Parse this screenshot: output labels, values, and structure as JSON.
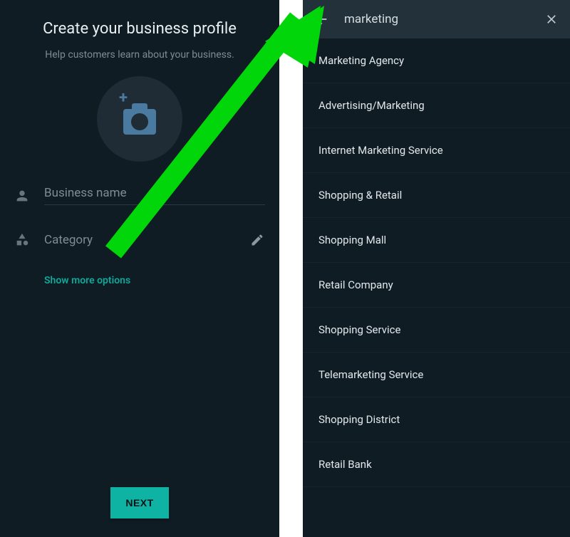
{
  "left": {
    "title": "Create your business profile",
    "subtitle": "Help customers learn about your business.",
    "business_name_placeholder": "Business name",
    "category_placeholder": "Category",
    "show_more": "Show more options",
    "next_label": "NEXT"
  },
  "right": {
    "search_query": "marketing",
    "results": [
      "Marketing Agency",
      "Advertising/Marketing",
      "Internet Marketing Service",
      "Shopping & Retail",
      "Shopping Mall",
      "Retail Company",
      "Shopping Service",
      "Telemarketing Service",
      "Shopping District",
      "Retail Bank"
    ]
  }
}
